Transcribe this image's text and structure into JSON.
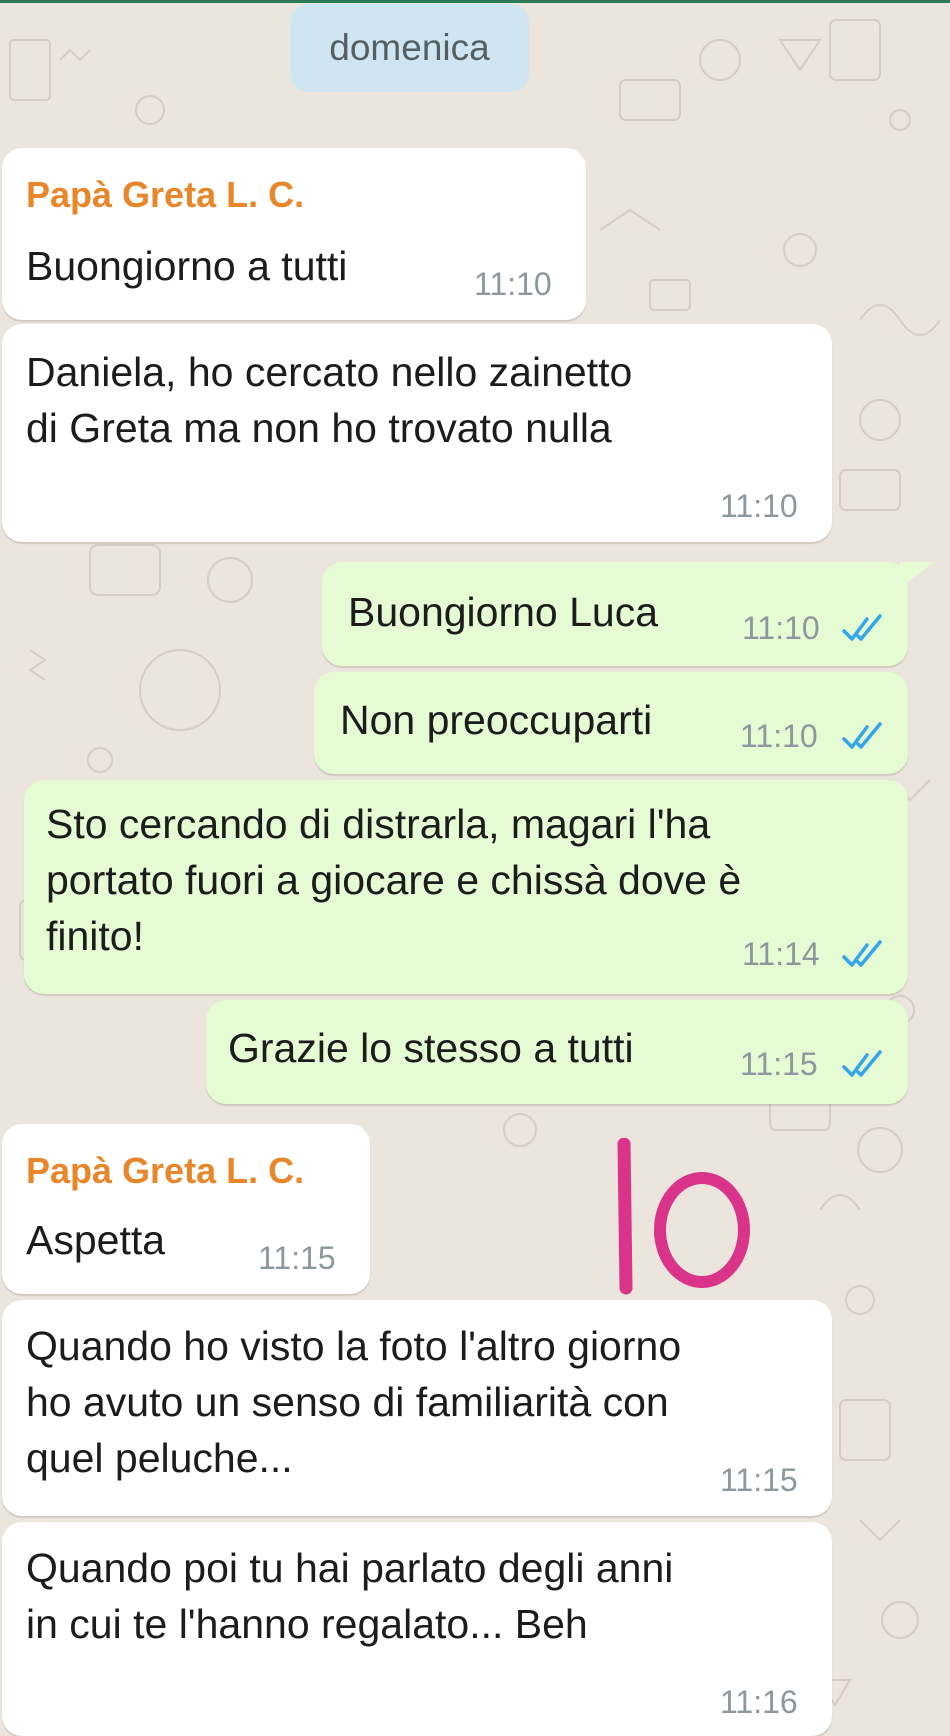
{
  "date_separator": "domenica",
  "colors": {
    "background": "#ece5dd",
    "incoming_bubble": "#ffffff",
    "outgoing_bubble": "#e4fbd3",
    "sender_name": "#e8862a",
    "read_ticks": "#34a6e8",
    "timestamp": "#8d979c",
    "doodle": "#d9338a"
  },
  "messages": [
    {
      "direction": "incoming",
      "sender": "Papà Greta L. C.",
      "lines": [
        "Buongiorno a tutti"
      ],
      "time": "11:10"
    },
    {
      "direction": "incoming",
      "lines": [
        "Daniela, ho cercato nello zainetto",
        "di Greta ma non ho trovato nulla"
      ],
      "time": "11:10"
    },
    {
      "direction": "outgoing",
      "lines": [
        "Buongiorno Luca"
      ],
      "time": "11:10",
      "status_icon": "double-check-read-icon"
    },
    {
      "direction": "outgoing",
      "lines": [
        "Non preoccuparti"
      ],
      "time": "11:10",
      "status_icon": "double-check-read-icon"
    },
    {
      "direction": "outgoing",
      "lines": [
        "Sto cercando di distrarla, magari l'ha",
        "portato fuori a giocare e chissà dove è",
        "finito!"
      ],
      "time": "11:14",
      "status_icon": "double-check-read-icon"
    },
    {
      "direction": "outgoing",
      "lines": [
        "Grazie lo stesso a tutti"
      ],
      "time": "11:15",
      "status_icon": "double-check-read-icon"
    },
    {
      "direction": "incoming",
      "sender": "Papà Greta L. C.",
      "lines": [
        "Aspetta"
      ],
      "time": "11:15"
    },
    {
      "direction": "incoming",
      "lines": [
        "Quando ho visto la foto l'altro giorno",
        "ho avuto un senso di familiarità con",
        "quel peluche..."
      ],
      "time": "11:15"
    },
    {
      "direction": "incoming",
      "lines": [
        "Quando poi tu hai parlato degli anni",
        "in cui te l'hanno regalato... Beh"
      ],
      "time": "11:16"
    }
  ],
  "handwritten_annotation": "10"
}
